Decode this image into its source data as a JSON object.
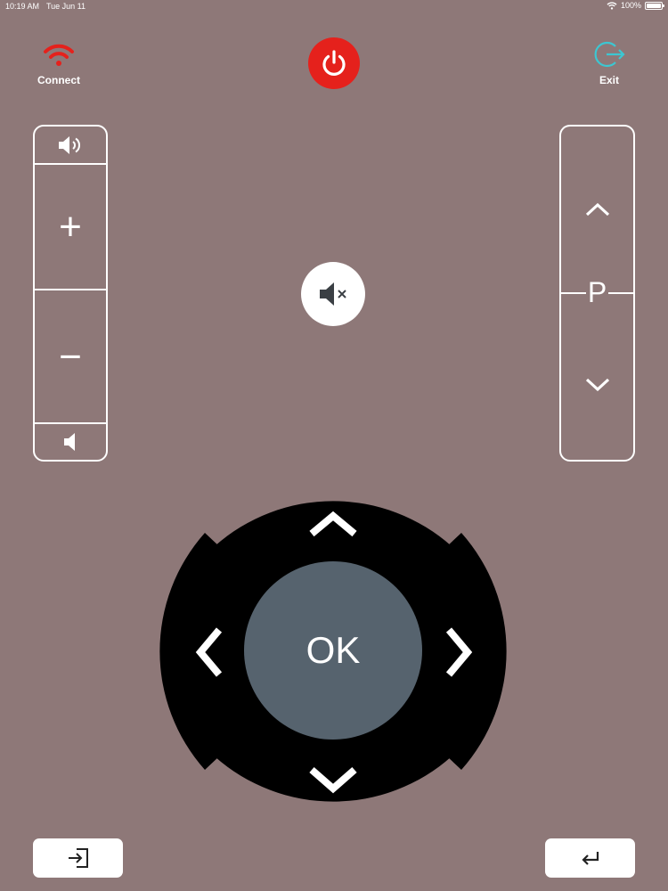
{
  "status_bar": {
    "time": "10:19 AM",
    "date": "Tue Jun 11",
    "battery": "100%",
    "wifi_icon": "wifi-icon",
    "battery_icon": "battery-icon"
  },
  "top": {
    "connect_label": "Connect",
    "exit_label": "Exit",
    "connect_icon": "wifi-icon",
    "power_icon": "power-icon",
    "exit_icon": "exit-icon"
  },
  "volume": {
    "up_symbol": "+",
    "down_symbol": "−",
    "speaker_icon": "speaker-icon"
  },
  "channel": {
    "label": "P",
    "up_icon": "chevron-up-icon",
    "down_icon": "chevron-down-icon"
  },
  "mute": {
    "icon": "mute-icon"
  },
  "dpad": {
    "ok_label": "OK",
    "icons": [
      "chevron-up-icon",
      "chevron-left-icon",
      "chevron-right-icon",
      "chevron-down-icon"
    ]
  },
  "bottom": {
    "input_icon": "input-source-icon",
    "back_icon": "return-icon"
  },
  "colors": {
    "background": "#8e7878",
    "power": "#e5211c",
    "connect_wifi": "#e5211c",
    "exit_accent": "#3cc7d2",
    "ok_fill": "#56636e",
    "dpad_fill": "#000000"
  }
}
